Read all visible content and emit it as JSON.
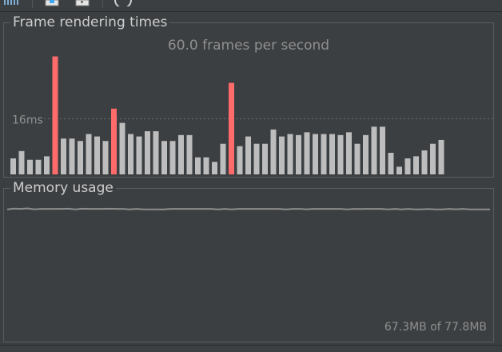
{
  "toolbar": {
    "icons": [
      "bars-chart-icon",
      "screenshot-icon",
      "record-icon",
      "refresh-icon"
    ]
  },
  "frame_panel": {
    "title": "Frame rendering times",
    "fps_label": "60.0 frames per second",
    "threshold_label": "16ms"
  },
  "memory_panel": {
    "title": "Memory usage",
    "usage_label": "67.3MB of 77.8MB"
  },
  "colors": {
    "background": "#3c3f41",
    "normal_bar": "#bdbdbd",
    "slow_bar": "#ff6b6b",
    "memory_line": "#8c8c8c",
    "threshold_line": "#6e6e6e"
  },
  "chart_data": [
    {
      "type": "bar",
      "title": "Frame rendering times",
      "subtitle": "60.0 frames per second",
      "threshold_ms": 16,
      "threshold_label": "16ms",
      "unit": "ms",
      "values": [
        4.6,
        6.7,
        4.2,
        4.2,
        5.2,
        33.9,
        10.3,
        10.3,
        9.6,
        11.6,
        10.9,
        9.6,
        18.9,
        14.8,
        11.6,
        10.9,
        12.4,
        12.4,
        9.6,
        9.6,
        11.3,
        11.3,
        4.9,
        4.9,
        3.6,
        8.8,
        26.3,
        8.1,
        10.9,
        8.8,
        8.8,
        12.9,
        10.9,
        11.6,
        11.3,
        12.1,
        11.6,
        11.6,
        11.6,
        11.3,
        12.1,
        8.8,
        11.3,
        13.7,
        13.7,
        6.2,
        2.2,
        4.6,
        5.2,
        6.9,
        8.8,
        9.9
      ],
      "slow": [
        false,
        false,
        false,
        false,
        false,
        true,
        false,
        false,
        false,
        false,
        false,
        false,
        true,
        false,
        false,
        false,
        false,
        false,
        false,
        false,
        false,
        false,
        false,
        false,
        false,
        false,
        true,
        false,
        false,
        false,
        false,
        false,
        false,
        false,
        false,
        false,
        false,
        false,
        false,
        false,
        false,
        false,
        false,
        false,
        false,
        false,
        false,
        false,
        false,
        false,
        false,
        false
      ]
    },
    {
      "type": "line",
      "title": "Memory usage",
      "unit": "MB",
      "max": 77.8,
      "current": 67.3,
      "values": [
        75.0,
        75.5,
        75.3,
        75.6,
        75.1,
        75.3,
        75.3,
        75.3,
        75.3,
        75.4,
        75.0,
        75.4,
        75.3,
        75.3,
        75.3,
        75.4,
        75.3,
        75.3,
        75.0,
        75.3,
        75.1,
        75.0,
        75.0,
        75.0,
        75.3,
        75.3,
        75.3,
        75.3,
        75.3,
        75.3,
        75.3,
        75.0,
        75.3,
        75.0,
        75.3,
        75.3,
        75.3,
        75.3,
        75.3,
        75.3,
        75.3,
        75.0,
        75.3,
        75.3,
        75.1,
        75.3,
        75.3,
        75.3,
        75.3,
        75.3,
        75.0,
        75.3,
        75.2,
        75.3,
        75.3,
        75.3,
        75.0,
        75.3,
        75.0,
        75.3,
        75.0,
        75.1,
        75.2,
        75.0,
        75.0,
        75.3,
        75.1,
        75.3,
        75.0,
        75.0,
        75.0,
        75.0
      ]
    }
  ]
}
